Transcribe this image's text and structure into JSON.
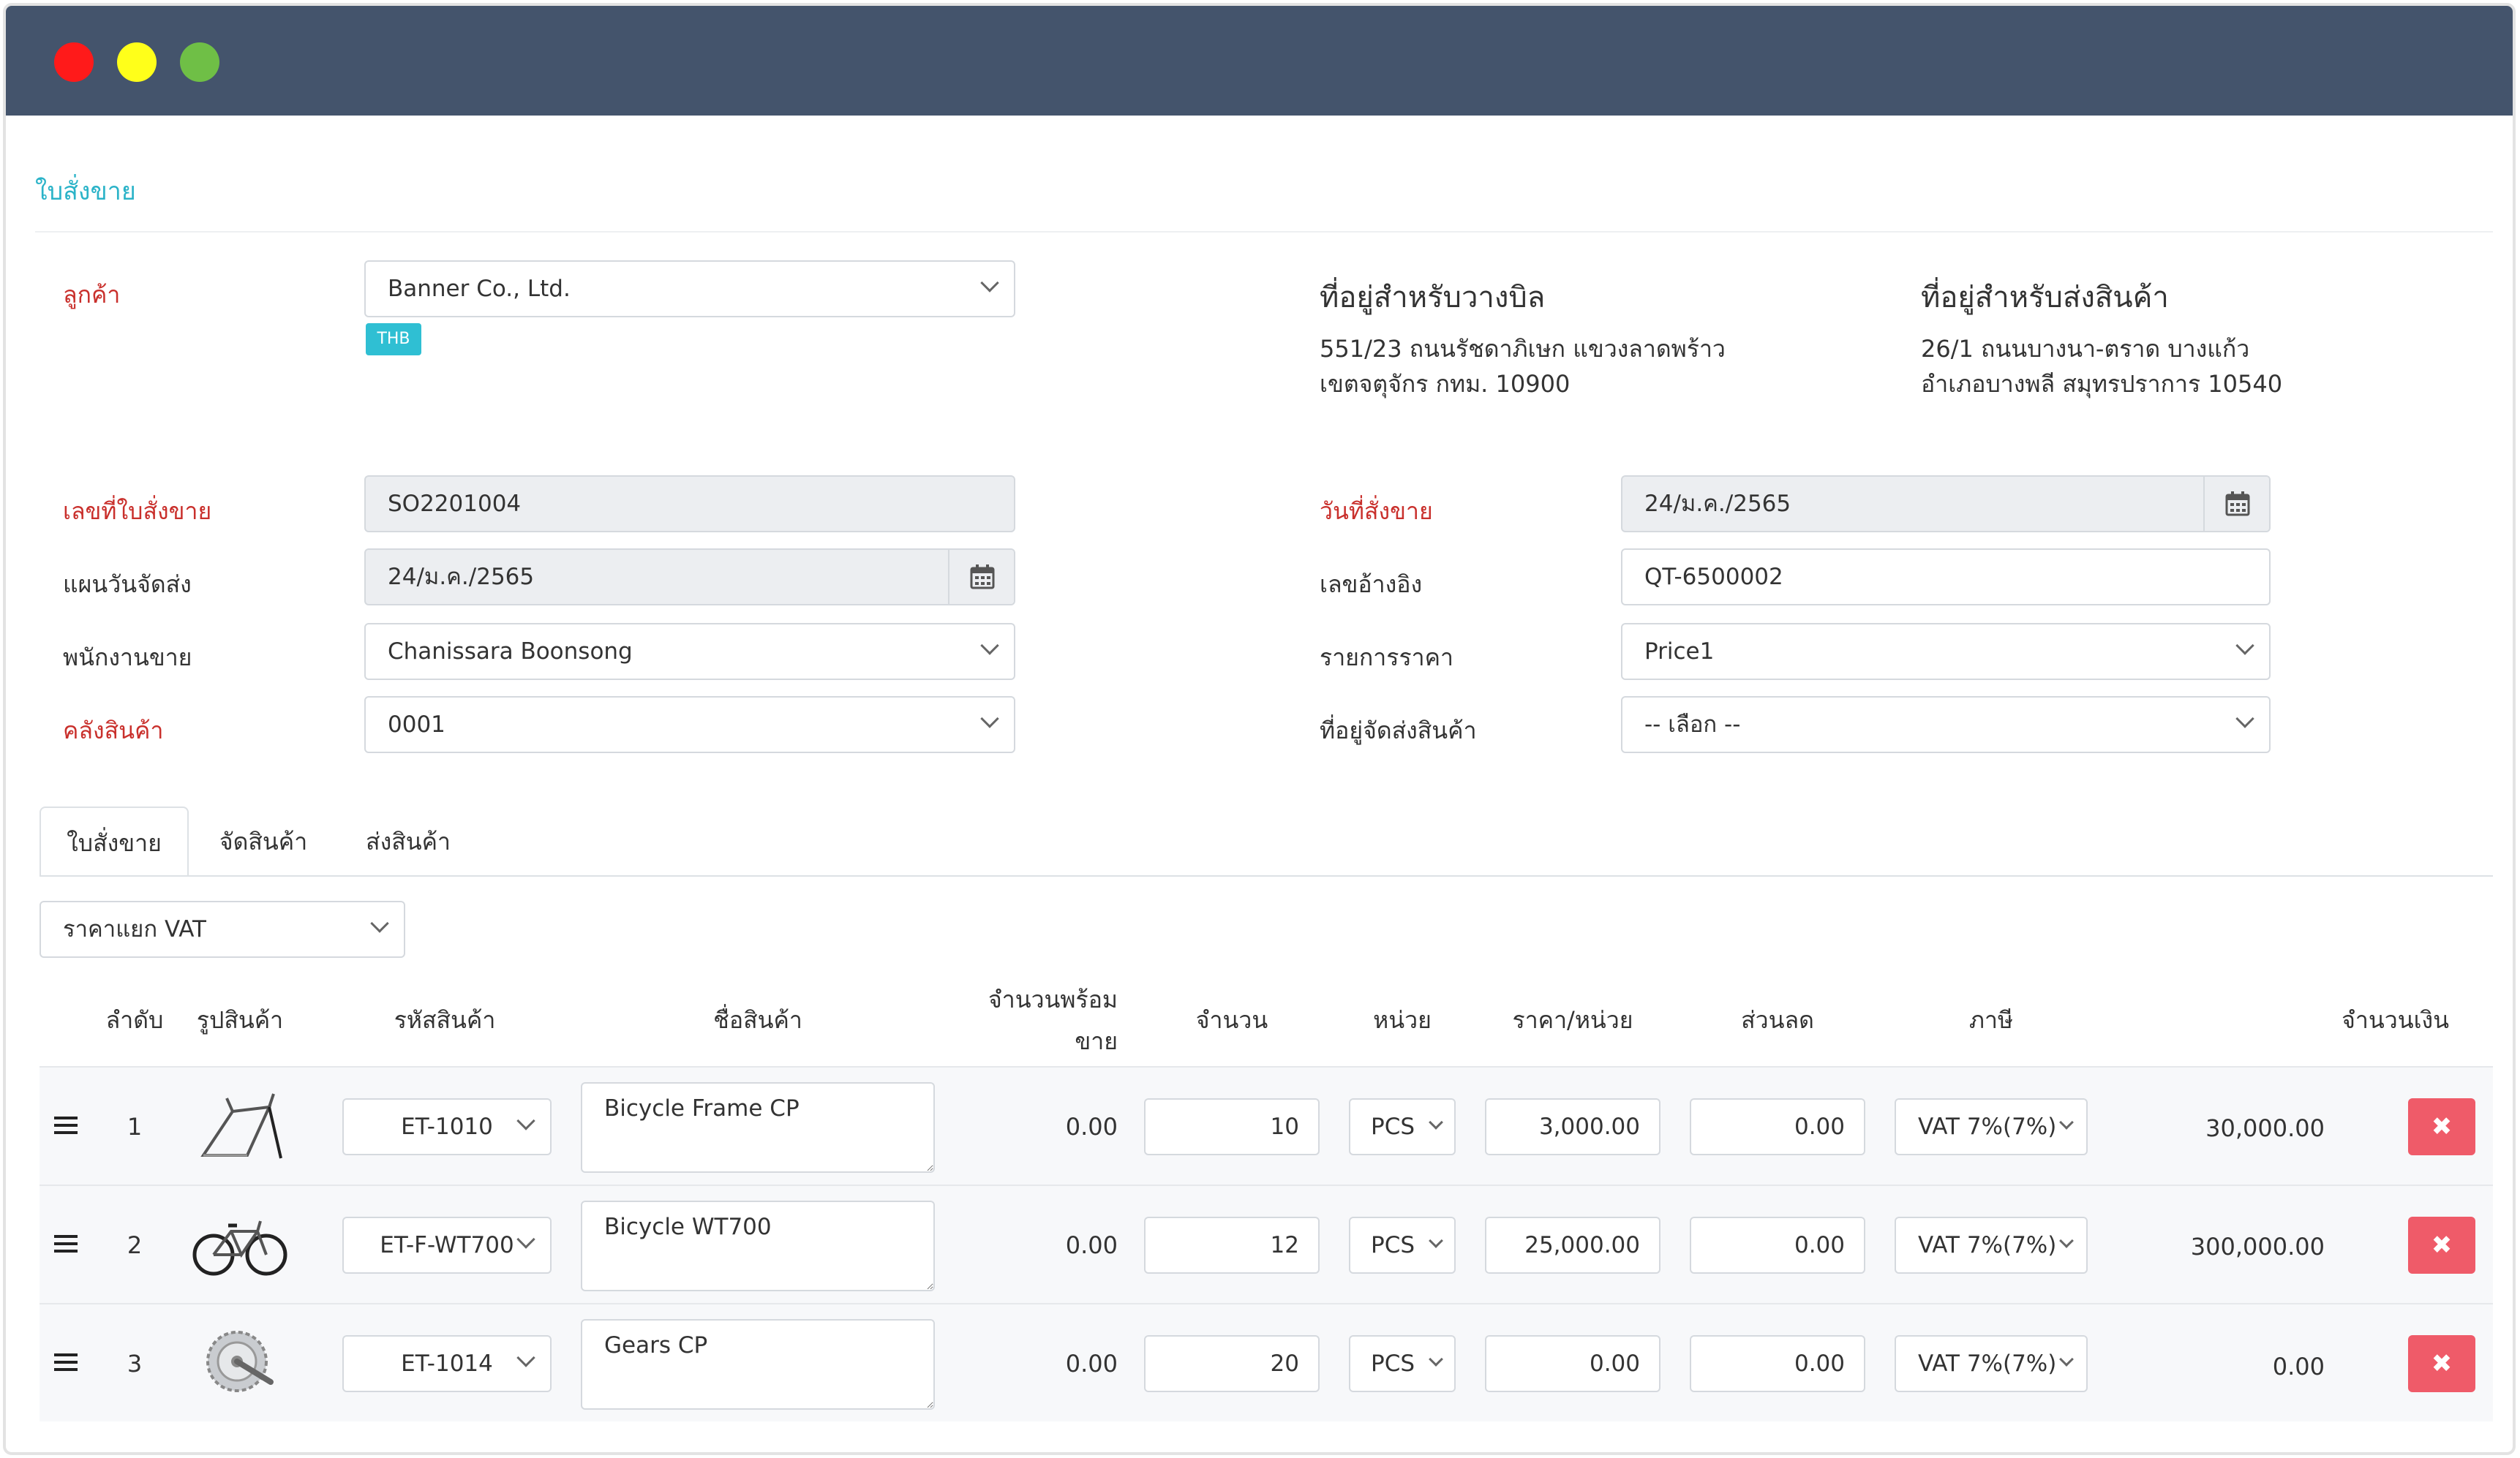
{
  "page": {
    "title": "ใบสั่งขาย"
  },
  "customer": {
    "label": "ลูกค้า",
    "value": "Banner Co., Ltd.",
    "currency_badge": "THB"
  },
  "billing": {
    "title": "ที่อยู่สำหรับวางบิล",
    "line1": "551/23 ถนนรัชดาภิเษก แขวงลาดพร้าว",
    "line2": "เขตจตุจักร กทม. 10900"
  },
  "shipping": {
    "title": "ที่อยู่สำหรับส่งสินค้า",
    "line1": "26/1 ถนนบางนา-ตราด บางแก้ว",
    "line2": "อำเภอบางพลี สมุทรปราการ 10540"
  },
  "form": {
    "so_number": {
      "label": "เลขที่ใบสั่งขาย",
      "value": "SO2201004"
    },
    "delivery_plan": {
      "label": "แผนวันจัดส่ง",
      "value": "24/ม.ค./2565"
    },
    "salesperson": {
      "label": "พนักงานขาย",
      "value": "Chanissara Boonsong"
    },
    "warehouse": {
      "label": "คลังสินค้า",
      "value": "0001"
    },
    "order_date": {
      "label": "วันที่สั่งขาย",
      "value": "24/ม.ค./2565"
    },
    "reference": {
      "label": "เลขอ้างอิง",
      "value": "QT-6500002"
    },
    "price_list": {
      "label": "รายการราคา",
      "value": "Price1"
    },
    "delivery_address": {
      "label": "ที่อยู่จัดส่งสินค้า",
      "value": "-- เลือก --"
    }
  },
  "tabs": [
    {
      "label": "ใบสั่งขาย"
    },
    {
      "label": "จัดสินค้า"
    },
    {
      "label": "ส่งสินค้า"
    }
  ],
  "vat_mode": {
    "value": "ราคาแยก VAT"
  },
  "table": {
    "headers": {
      "no": "ลำดับ",
      "image": "รูปสินค้า",
      "code": "รหัสสินค้า",
      "name": "ชื่อสินค้า",
      "available_1": "จำนวนพร้อม",
      "available_2": "ขาย",
      "qty": "จำนวน",
      "unit": "หน่วย",
      "price": "ราคา/หน่วย",
      "discount": "ส่วนลด",
      "tax": "ภาษี",
      "amount": "จำนวนเงิน"
    },
    "rows": [
      {
        "no": "1",
        "image": "bicycle-frame",
        "code": "ET-1010",
        "name": "Bicycle Frame CP",
        "available": "0.00",
        "qty": "10",
        "unit": "PCS",
        "price": "3,000.00",
        "discount": "0.00",
        "tax": "VAT 7%(7%)",
        "amount": "30,000.00"
      },
      {
        "no": "2",
        "image": "bicycle",
        "code": "ET-F-WT700",
        "name": "Bicycle WT700",
        "available": "0.00",
        "qty": "12",
        "unit": "PCS",
        "price": "25,000.00",
        "discount": "0.00",
        "tax": "VAT 7%(7%)",
        "amount": "300,000.00"
      },
      {
        "no": "3",
        "image": "gear-crankset",
        "code": "ET-1014",
        "name": "Gears CP",
        "available": "0.00",
        "qty": "20",
        "unit": "PCS",
        "price": "0.00",
        "discount": "0.00",
        "tax": "VAT 7%(7%)",
        "amount": "0.00"
      }
    ]
  },
  "icons": {
    "delete": "✖"
  },
  "colors": {
    "titlebar": "#44546c",
    "accent": "#2bb3c8",
    "required": "#c9302c",
    "delete": "#ef5b69"
  }
}
